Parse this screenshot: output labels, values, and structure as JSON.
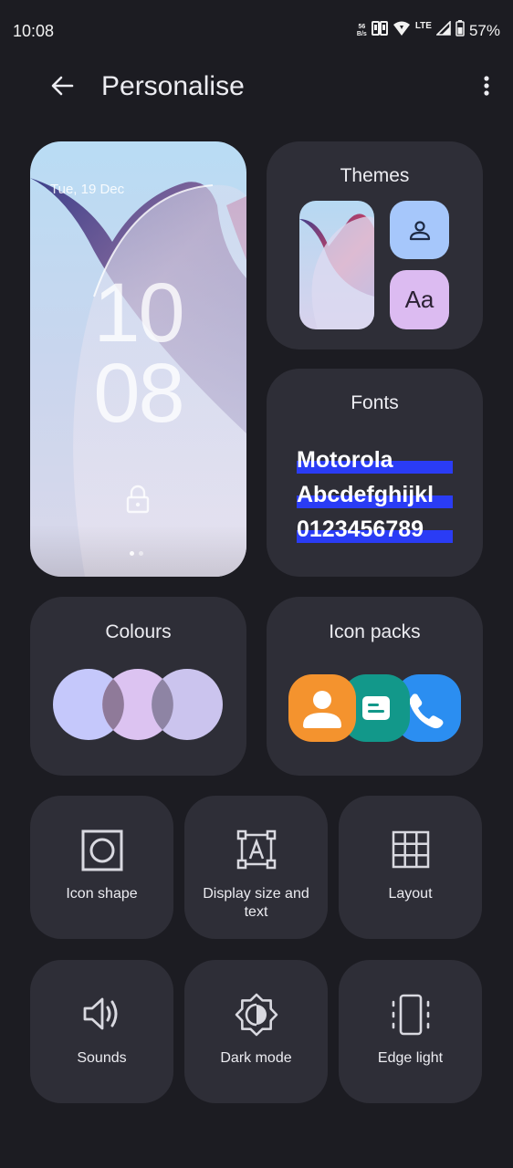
{
  "status_bar": {
    "time": "10:08",
    "net_speed_value": "56",
    "net_speed_unit": "B/s",
    "network": "LTE",
    "battery": "57%"
  },
  "app_bar": {
    "title": "Personalise",
    "back_icon": "arrow-left-icon",
    "menu_icon": "more-vert-icon"
  },
  "wallpaper": {
    "date": "Tue, 19 Dec",
    "hour": "10",
    "minute": "08",
    "lock_icon": "lock-icon",
    "page_count": 2,
    "page_index": 0
  },
  "cards": {
    "themes": {
      "title": "Themes",
      "avatar_icon": "person-icon",
      "font_glyph": "Aa"
    },
    "fonts": {
      "title": "Fonts",
      "samples": [
        "Motorola",
        "Abcdefghijkl",
        "0123456789"
      ]
    },
    "colours": {
      "title": "Colours",
      "swatches": [
        "#c5c8fb",
        "#dcc3f1",
        "#cbc4ee"
      ]
    },
    "icon_packs": {
      "title": "Icon packs",
      "icons": [
        "contacts-icon",
        "messages-icon",
        "phone-icon"
      ]
    }
  },
  "tiles": [
    {
      "label": "Icon shape",
      "icon": "icon-shape-icon"
    },
    {
      "label": "Display size and text",
      "icon": "display-size-icon"
    },
    {
      "label": "Layout",
      "icon": "grid-layout-icon"
    },
    {
      "label": "Sounds",
      "icon": "volume-icon"
    },
    {
      "label": "Dark mode",
      "icon": "dark-mode-icon"
    },
    {
      "label": "Edge light",
      "icon": "edge-light-icon"
    }
  ],
  "colors": {
    "background": "#1c1c22",
    "card": "#2e2e37",
    "font_highlight": "#2a3cf5",
    "theme_avatar_bg": "#a6c7fb",
    "theme_font_bg": "#dcbbf1",
    "icon_contacts": "#f4932e",
    "icon_messages": "#12988a",
    "icon_phone": "#2b8ef1"
  }
}
